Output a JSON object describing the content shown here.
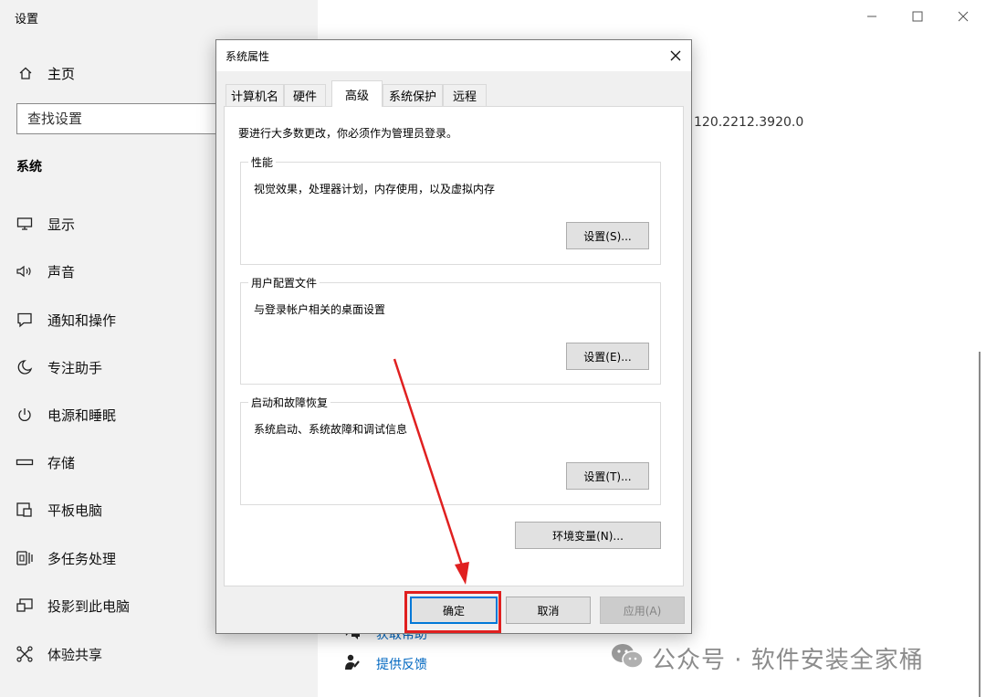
{
  "settings": {
    "title": "设置",
    "home_label": "主页",
    "search_placeholder": "查找设置",
    "section_title": "系统",
    "nav_items": [
      {
        "label": "显示",
        "icon": "monitor-icon"
      },
      {
        "label": "声音",
        "icon": "speaker-icon"
      },
      {
        "label": "通知和操作",
        "icon": "notification-icon"
      },
      {
        "label": "专注助手",
        "icon": "moon-icon"
      },
      {
        "label": "电源和睡眠",
        "icon": "power-icon"
      },
      {
        "label": "存储",
        "icon": "storage-icon"
      },
      {
        "label": "平板电脑",
        "icon": "tablet-icon"
      },
      {
        "label": "多任务处理",
        "icon": "multitask-icon"
      },
      {
        "label": "投影到此电脑",
        "icon": "project-icon"
      },
      {
        "label": "体验共享",
        "icon": "share-icon"
      }
    ],
    "version_fragment": "120.2212.3920.0",
    "links": {
      "get_help": "获取帮助",
      "feedback": "提供反馈"
    }
  },
  "dialog": {
    "title": "系统属性",
    "tabs": [
      "计算机名",
      "硬件",
      "高级",
      "系统保护",
      "远程"
    ],
    "active_tab": "高级",
    "admin_note": "要进行大多数更改，你必须作为管理员登录。",
    "groups": {
      "performance": {
        "label": "性能",
        "desc": "视觉效果，处理器计划，内存使用，以及虚拟内存",
        "button": "设置(S)..."
      },
      "user_profiles": {
        "label": "用户配置文件",
        "desc": "与登录帐户相关的桌面设置",
        "button": "设置(E)..."
      },
      "startup": {
        "label": "启动和故障恢复",
        "desc": "系统启动、系统故障和调试信息",
        "button": "设置(T)..."
      }
    },
    "env_button": "环境变量(N)...",
    "ok_button": "确定",
    "cancel_button": "取消",
    "apply_button": "应用(A)"
  },
  "watermark": {
    "text": "公众号 · 软件安装全家桶"
  },
  "colors": {
    "annotation_red": "#e02020",
    "link_blue": "#0067c0",
    "focus_blue": "#0078d7"
  }
}
